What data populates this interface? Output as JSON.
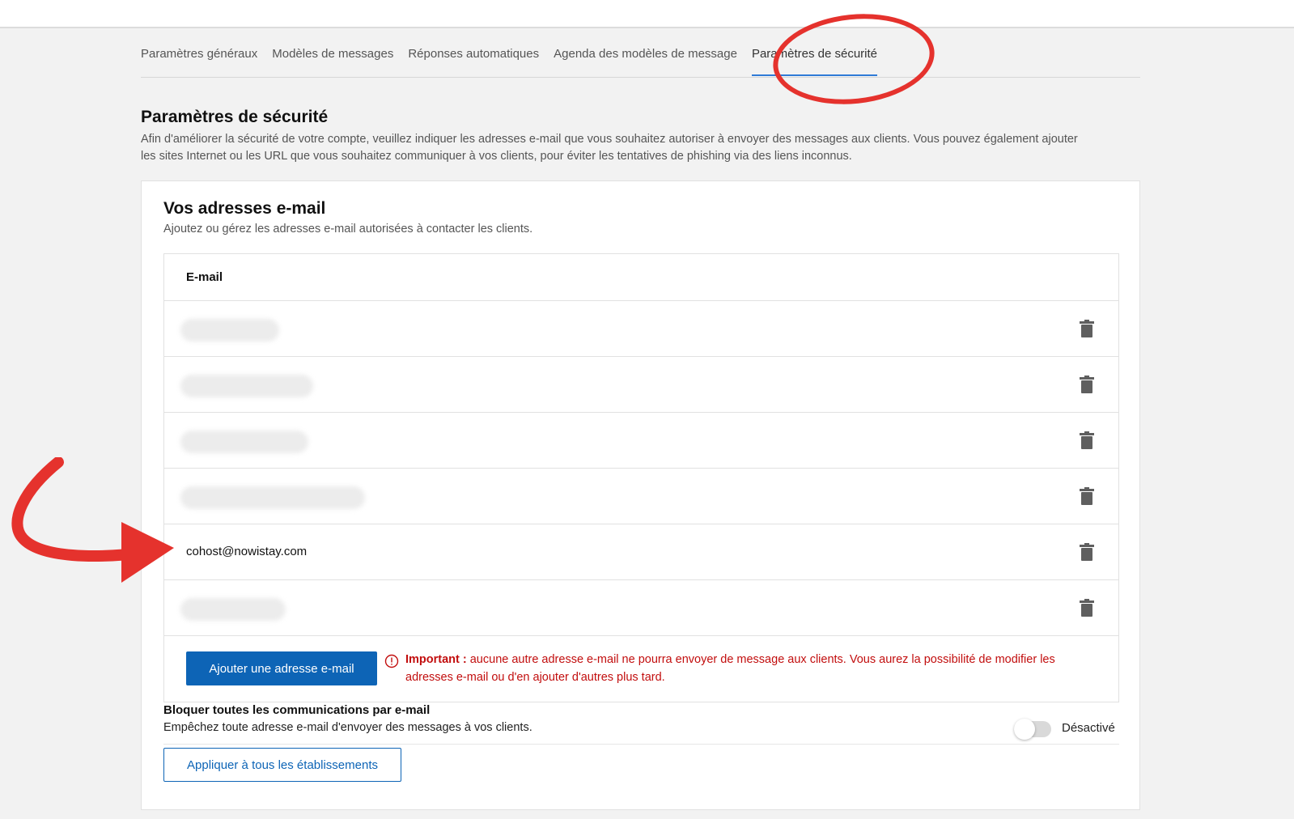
{
  "tabs": [
    {
      "label": "Paramètres généraux"
    },
    {
      "label": "Modèles de messages"
    },
    {
      "label": "Réponses automatiques"
    },
    {
      "label": "Agenda des modèles de message"
    },
    {
      "label": "Paramètres de sécurité",
      "active": true
    }
  ],
  "page": {
    "title": "Paramètres de sécurité",
    "description": "Afin d'améliorer la sécurité de votre compte, veuillez indiquer les adresses e-mail que vous souhaitez autoriser à envoyer des messages aux clients. Vous pouvez également ajouter les sites Internet ou les URL que vous souhaitez communiquer à vos clients, pour éviter les tentatives de phishing via des liens inconnus."
  },
  "emails_card": {
    "title": "Vos adresses e-mail",
    "subtitle": "Ajoutez ou gérez les adresses e-mail autorisées à contacter les clients.",
    "column_header": "E-mail",
    "rows": [
      {
        "email": "",
        "redacted": true
      },
      {
        "email": "",
        "redacted": true
      },
      {
        "email": "",
        "redacted": true
      },
      {
        "email": "",
        "redacted": true
      },
      {
        "email": "cohost@nowistay.com",
        "redacted": false
      },
      {
        "email": "",
        "redacted": true
      }
    ],
    "add_button": "Ajouter une adresse e-mail",
    "warning_label": "Important :",
    "warning_text": " aucune autre adresse e-mail ne pourra envoyer de message aux clients. Vous aurez la possibilité de modifier les adresses e-mail ou d'en ajouter d'autres plus tard."
  },
  "block": {
    "title": "Bloquer toutes les communications par e-mail",
    "description": "Empêchez toute adresse e-mail d'envoyer des messages à vos clients.",
    "toggle_state": "Désactivé",
    "toggle_on": false,
    "apply_button": "Appliquer à tous les établissements"
  },
  "colors": {
    "primary": "#0d64b6",
    "warning": "#c20e0e",
    "annotation": "#e5322d",
    "tab_underline": "#2f7bd6"
  }
}
